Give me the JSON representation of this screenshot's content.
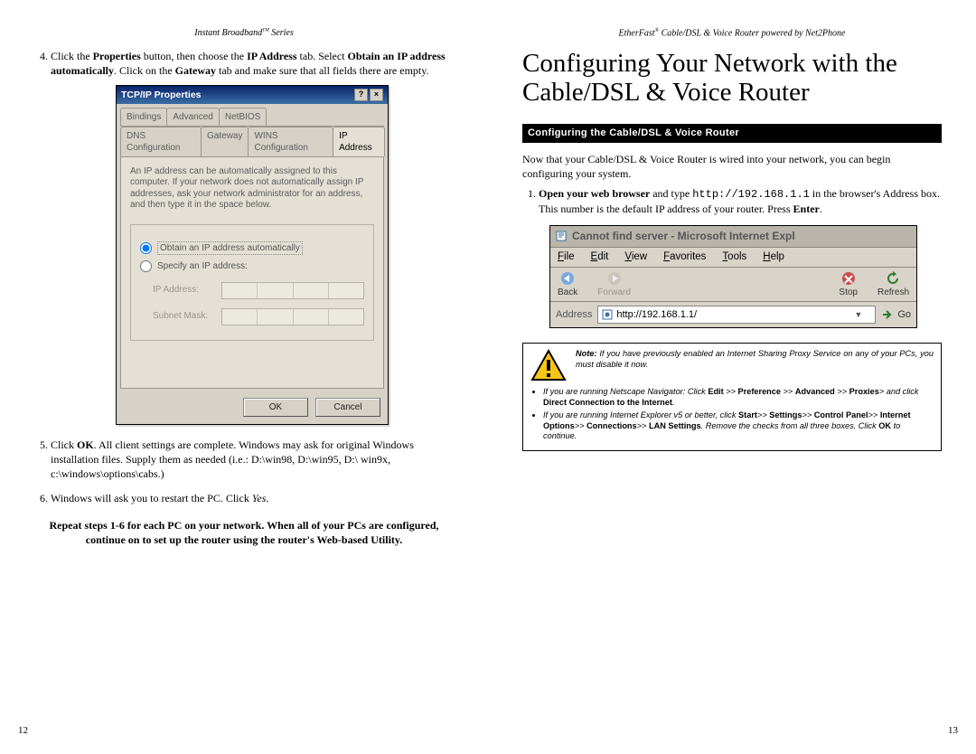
{
  "left": {
    "running_head_pre": "Instant Broadband",
    "running_head_tm": "TM",
    "running_head_post": " Series",
    "step4_a": "Click the ",
    "step4_b": "Properties",
    "step4_c": " button, then choose the ",
    "step4_d": "IP Address",
    "step4_e": " tab. Select ",
    "step4_f": "Obtain an IP address automatically",
    "step4_g": ". Click on the ",
    "step4_h": "Gateway",
    "step4_i": " tab and make sure that all fields there are empty.",
    "dialog": {
      "title": "TCP/IP Properties",
      "tabs1": [
        "Bindings",
        "Advanced",
        "NetBIOS"
      ],
      "tabs2": [
        "DNS Configuration",
        "Gateway",
        "WINS Configuration",
        "IP Address"
      ],
      "desc": "An IP address can be automatically assigned to this computer. If your network does not automatically assign IP addresses, ask your network administrator for an address, and then type it in the space below.",
      "radio_auto": "Obtain an IP address automatically",
      "radio_spec": "Specify an IP address:",
      "lbl_ip": "IP Address:",
      "lbl_mask": "Subnet Mask:",
      "ok": "OK",
      "cancel": "Cancel"
    },
    "step5_a": "Click ",
    "step5_b": "OK",
    "step5_c": ".  All client settings are complete.  Windows may ask for original Windows installation files. Supply them as needed (i.e.: D:\\win98, D:\\win95, D:\\ win9x, c:\\windows\\options\\cabs.)",
    "step6_a": "Windows will ask you to restart the PC. Click ",
    "step6_b": "Yes",
    "step6_c": ".",
    "repeat": "Repeat steps 1-6 for each PC on your network.  When all of your PCs are configured,  continue on to set up the router using the router's Web-based Utility.",
    "page_no": "12"
  },
  "right": {
    "running_head_pre": "EtherFast",
    "running_head_reg": "®",
    "running_head_post": " Cable/DSL & Voice Router powered by Net2Phone",
    "main_head": "Configuring Your Network with the Cable/DSL & Voice Router",
    "black_bar": "Configuring the Cable/DSL & Voice Router",
    "intro": "Now that your Cable/DSL & Voice Router is wired into your network, you can begin configuring your system.",
    "s1_a": "Open your web browser",
    "s1_b": " and type ",
    "s1_url": "http://192.168.1.1",
    "s1_c": " in the browser's Address box. This number is the default IP address of your router. Press ",
    "s1_d": "Enter",
    "s1_e": ".",
    "browser": {
      "title": "Cannot find server - Microsoft Internet Expl",
      "menu": {
        "file": "File",
        "edit": "Edit",
        "view": "View",
        "fav": "Favorites",
        "tools": "Tools",
        "help": "Help"
      },
      "tool": {
        "back": "Back",
        "fwd": "Forward",
        "stop": "Stop",
        "refresh": "Refresh"
      },
      "addr_label": "Address",
      "url": "http://192.168.1.1/",
      "go": "Go"
    },
    "note": {
      "lead_label": "Note:",
      "lead_text": " If you have previously enabled an Internet Sharing Proxy Service on any of your PCs, you must disable it now.",
      "b1_a": "If you are running Netscape Navigator: Click ",
      "b1_b": "Edit",
      "b1_c": " >> ",
      "b1_d": "Preference",
      "b1_e": " >> ",
      "b1_f": "Advanced",
      "b1_g": " >> ",
      "b1_h": "Proxies",
      "b1_i": "> and click ",
      "b1_j": "Direct Connection to the Internet",
      "b1_k": ".",
      "b2_a": "If you are running Internet Explorer v5 or better, click ",
      "b2_b": "Start",
      "b2_c": ">> ",
      "b2_d": "Settings",
      "b2_e": ">> ",
      "b2_f": "Control Panel",
      "b2_g": ">> ",
      "b2_h": "Internet Options",
      "b2_i": ">> ",
      "b2_j": "Connections",
      "b2_k": ">> ",
      "b2_l": "LAN Settings",
      "b2_m": ". Remove the checks from  all three boxes. Click ",
      "b2_n": "OK",
      "b2_o": " to continue."
    },
    "page_no": "13"
  }
}
